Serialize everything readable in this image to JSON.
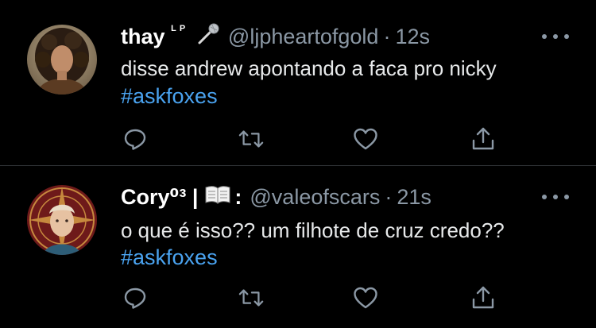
{
  "colors": {
    "background": "#000000",
    "divider": "#2f3336",
    "secondary_text": "#8b98a5",
    "hashtag": "#4aa3f0"
  },
  "tweets": [
    {
      "display_name": "thay",
      "name_suffix": "ᴸ ᴾ",
      "name_emoji": "microphone-icon",
      "handle": "@ljpheartofgold",
      "separator": "·",
      "time": "12s",
      "text": "disse andrew apontando a faca pro nicky",
      "hashtag": "#askfoxes",
      "actions": [
        "reply-icon",
        "retweet-icon",
        "like-icon",
        "share-icon"
      ]
    },
    {
      "display_name": "Cory⁰³ |",
      "name_emoji": "open-book-icon",
      "name_suffix": ":",
      "handle": "@valeofscars",
      "separator": "·",
      "time": "21s",
      "text": "o que é isso?? um filhote de cruz credo??",
      "hashtag": "#askfoxes",
      "actions": [
        "reply-icon",
        "retweet-icon",
        "like-icon",
        "share-icon"
      ]
    }
  ]
}
